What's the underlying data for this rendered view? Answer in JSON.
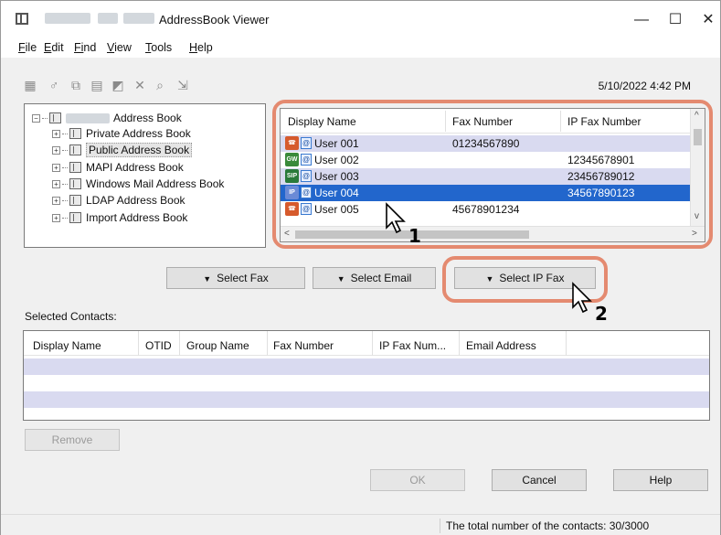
{
  "window": {
    "title": "AddressBook Viewer",
    "minimize": "—",
    "maximize": "☐",
    "close": "✕"
  },
  "menu": [
    {
      "key": "F",
      "rest": "ile"
    },
    {
      "key": "E",
      "rest": "dit"
    },
    {
      "key": "Fi",
      "rest": "nd"
    },
    {
      "key": "V",
      "rest": "iew"
    },
    {
      "key": "T",
      "rest": "ools"
    },
    {
      "key": "H",
      "rest": "elp"
    }
  ],
  "toolbar": {
    "icons": [
      "new-entry-icon",
      "new-group-icon",
      "copy-icon",
      "paste-icon",
      "properties-icon",
      "delete-icon",
      "search-icon",
      "import-icon"
    ],
    "datetime": "5/10/2022 4:42 PM"
  },
  "tree": {
    "root": "Address Book",
    "items": [
      "Private Address Book",
      "Public Address Book",
      "MAPI Address Book",
      "Windows Mail Address Book",
      "LDAP Address Book",
      "Import Address Book"
    ]
  },
  "contacts": {
    "columns": [
      "Display Name",
      "Fax Number",
      "IP Fax Number"
    ],
    "rows": [
      {
        "icon": "fax",
        "name": "User 001",
        "fax": "01234567890",
        "ipfax": ""
      },
      {
        "icon": "GW",
        "name": "User 002",
        "fax": "",
        "ipfax": "12345678901"
      },
      {
        "icon": "SIP",
        "name": "User 003",
        "fax": "",
        "ipfax": "23456789012"
      },
      {
        "icon": "IP",
        "name": "User 004",
        "fax": "",
        "ipfax": "34567890123"
      },
      {
        "icon": "fax",
        "name": "User 005",
        "fax": "45678901234",
        "ipfax": ""
      }
    ]
  },
  "buttons": {
    "select_fax": "Select Fax",
    "select_email": "Select Email",
    "select_ip_fax": "Select IP Fax",
    "remove": "Remove",
    "ok": "OK",
    "cancel": "Cancel",
    "help": "Help"
  },
  "selected": {
    "label": "Selected Contacts:",
    "columns": [
      "Display Name",
      "OTID",
      "Group Name",
      "Fax Number",
      "IP Fax Num...",
      "Email Address"
    ]
  },
  "status": "The total number of the contacts: 30/3000",
  "callouts": [
    "1",
    "2"
  ],
  "colors": {
    "highlight": "#e48a70",
    "selection": "#2266cc",
    "stripe": "#d9daf0"
  }
}
